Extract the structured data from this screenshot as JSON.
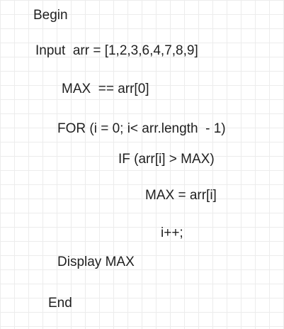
{
  "pseudocode": {
    "begin": "Begin",
    "input": "Input  arr = [1,2,3,6,4,7,8,9]",
    "max_init": "MAX  == arr[0]",
    "for_loop": "FOR (i = 0; i< arr.length  - 1)",
    "if_cond": "IF (arr[i] > MAX)",
    "assign": "MAX = arr[i]",
    "increment": "i++;",
    "display": "Display MAX",
    "end": "End"
  }
}
